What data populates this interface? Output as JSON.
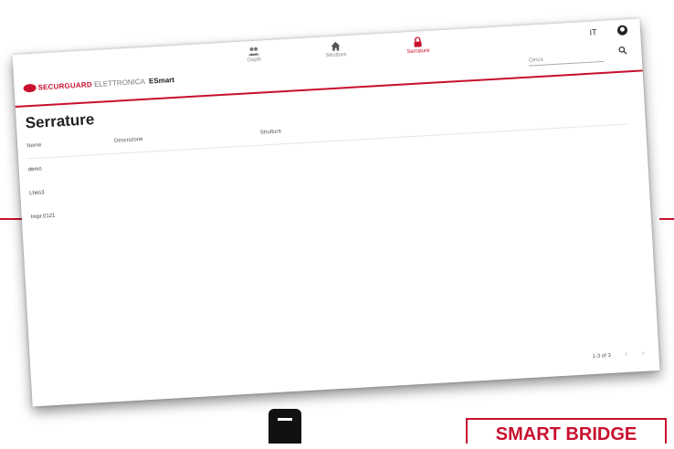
{
  "colors": {
    "accent": "#c8102e",
    "text": "#222222",
    "muted": "#888888"
  },
  "brand": {
    "name": "SECURGUARD",
    "subtitle": "ELETTRONICA",
    "app": "ESmart"
  },
  "nav": [
    {
      "label": "Ospiti",
      "icon": "people-icon"
    },
    {
      "label": "Strutture",
      "icon": "home-icon"
    },
    {
      "label": "Serrature",
      "icon": "lock-icon",
      "active": true
    }
  ],
  "header": {
    "lang": "IT",
    "search_placeholder": "Cerca"
  },
  "page": {
    "title": "Serrature"
  },
  "table": {
    "columns": [
      "Nome",
      "Descrizione",
      "Struttura"
    ],
    "rows": [
      {
        "name": "demo"
      },
      {
        "name": "Lhes3"
      },
      {
        "name": "Impr.0121"
      }
    ]
  },
  "pagination": {
    "range": "1-3 of 3",
    "prev": "‹",
    "next": "›"
  },
  "badge": {
    "label": "SMART BRIDGE"
  }
}
